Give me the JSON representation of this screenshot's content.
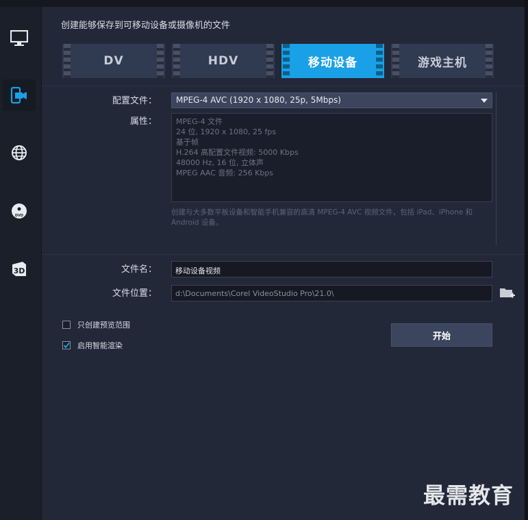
{
  "sidebar": {
    "items": [
      {
        "icon": "monitor-icon",
        "label": ""
      },
      {
        "icon": "mobile-camera-icon",
        "label": "",
        "active": true
      },
      {
        "icon": "globe-icon",
        "label": ""
      },
      {
        "icon": "dvd-icon",
        "label": "DVD"
      },
      {
        "icon": "3d-icon",
        "label": "3D"
      }
    ]
  },
  "header": {
    "title": "创建能够保存到可移动设备或摄像机的文件"
  },
  "tabs": [
    {
      "label": "DV",
      "active": false
    },
    {
      "label": "HDV",
      "active": false
    },
    {
      "label": "移动设备",
      "active": true
    },
    {
      "label": "游戏主机",
      "active": false
    }
  ],
  "profile": {
    "label": "配置文件：",
    "value": "MPEG-4 AVC (1920 x 1080, 25p, 5Mbps)"
  },
  "properties": {
    "label": "属性：",
    "lines": [
      "MPEG-4 文件",
      "24 位, 1920 x 1080, 25 fps",
      "基于帧",
      "H.264 高配置文件视频: 5000 Kbps",
      "48000 Hz, 16 位, 立体声",
      "MPEG AAC 音频: 256 Kbps"
    ]
  },
  "description": "创建与大多数平板设备和智能手机兼容的高清 MPEG-4 AVC 视频文件，包括 iPad、iPhone 和 Android 设备。",
  "filename": {
    "label": "文件名：",
    "value": "移动设备视频"
  },
  "location": {
    "label": "文件位置：",
    "value": "d:\\Documents\\Corel VideoStudio Pro\\21.0\\"
  },
  "options": {
    "preview_range": {
      "label": "只创建预览范围",
      "checked": false
    },
    "smart_render": {
      "label": "启用智能渲染",
      "checked": true
    }
  },
  "start_button": {
    "label": "开始"
  },
  "watermark": "最需教育",
  "colors": {
    "accent": "#1aa0e6",
    "background": "#222838",
    "sidebar": "#1b1f29"
  }
}
